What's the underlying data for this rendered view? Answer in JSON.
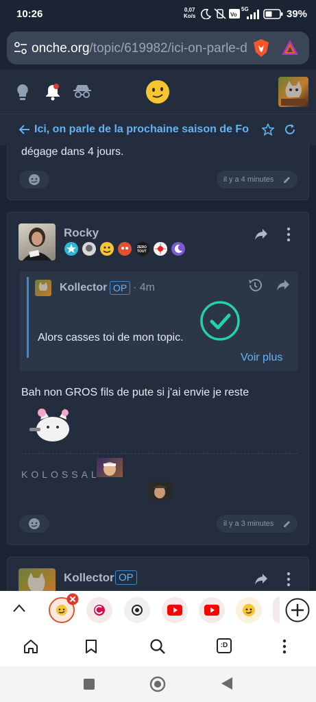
{
  "status": {
    "time": "10:26",
    "speed_value": "0,07",
    "speed_unit": "Ko/s",
    "network": "5G",
    "battery": "39%"
  },
  "browser": {
    "url_host": "onche.org",
    "url_path": "/topic/619982/ici-on-parle-d"
  },
  "topic": {
    "title": "Ici, on parle de la prochaine saison de Fo"
  },
  "prev_post": {
    "text": "dégage dans 4 jours.",
    "time": "il y a 4 minutes"
  },
  "post": {
    "author": "Rocky",
    "quote": {
      "author": "Kollector",
      "op_label": "OP",
      "time": "· 4m",
      "text": "Alors casses toi de mon topic.",
      "more": "Voir plus"
    },
    "text": "Bah non GROS fils de pute si j'ai envie je reste",
    "signature": "KOLOSSAL",
    "time": "il y a 3 minutes"
  },
  "next_post": {
    "author": "Kollector",
    "op_label": "OP"
  },
  "bottom_nav": {
    "tabs_label": ":D"
  },
  "colors": {
    "accent": "#5fb5f5",
    "op_border": "#3a8bd0",
    "check": "#23d2a8",
    "badge_red": "#e03a2f"
  }
}
